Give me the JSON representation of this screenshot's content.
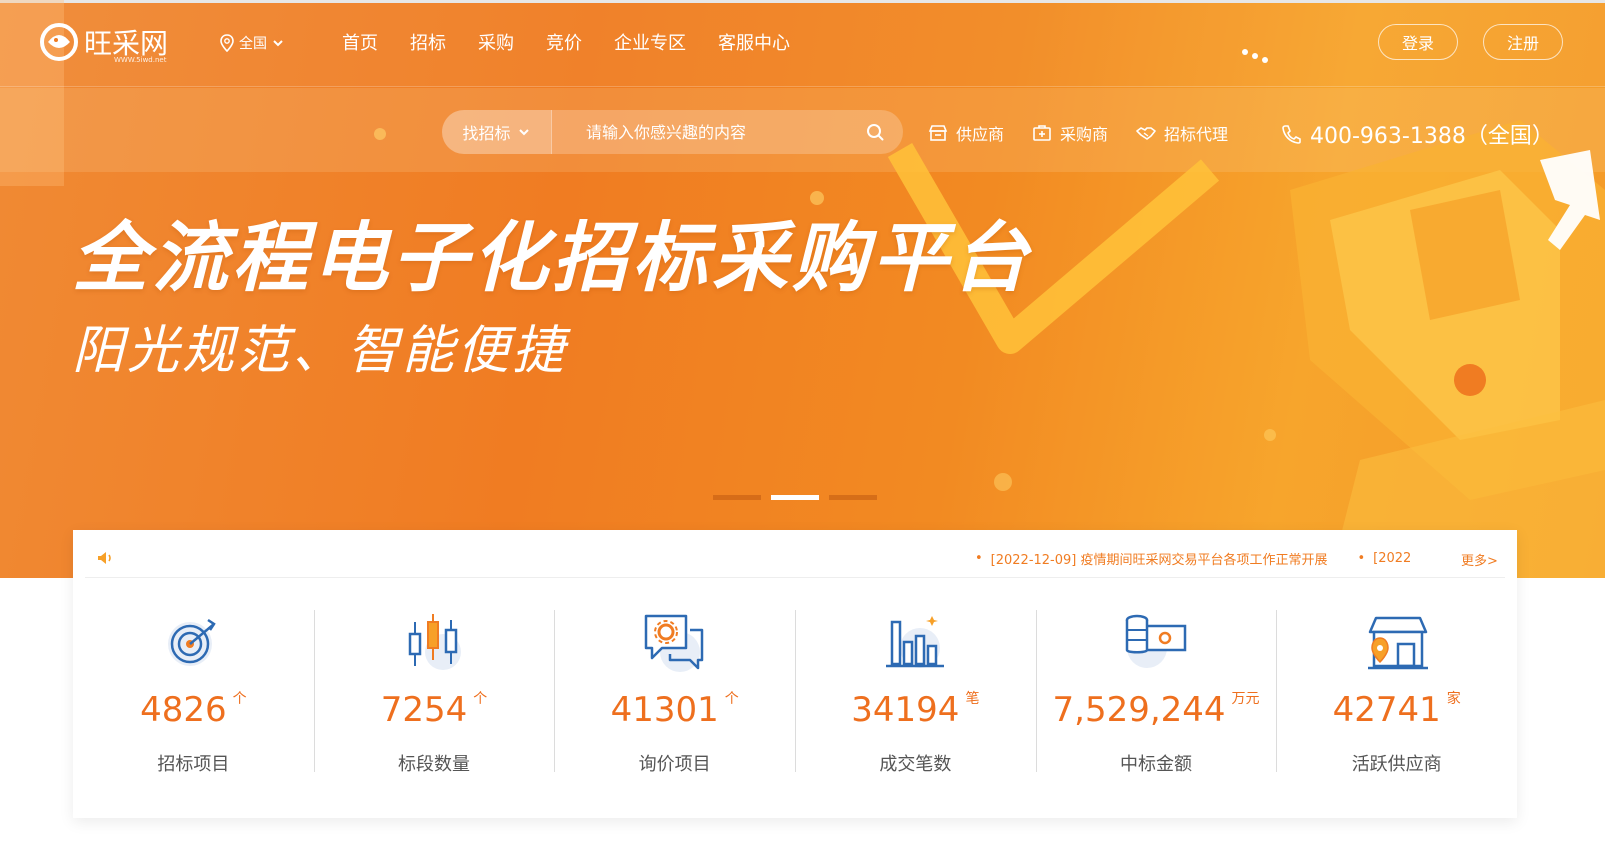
{
  "colors": {
    "brand": "#f07c22",
    "number": "#ee6f1e",
    "white": "#ffffff",
    "label": "#555555"
  },
  "header": {
    "logo_text": "旺采网",
    "logo_sub": "WWW.5iwd.net",
    "region": "全国",
    "nav": [
      "首页",
      "招标",
      "采购",
      "竞价",
      "企业专区",
      "客服中心"
    ],
    "login": "登录",
    "register": "注册"
  },
  "search": {
    "type": "找招标",
    "placeholder": "请输入你感兴趣的内容",
    "icon": "search-icon"
  },
  "quick_links": [
    {
      "label": "供应商",
      "icon": "shop-icon"
    },
    {
      "label": "采购商",
      "icon": "purchase-icon"
    },
    {
      "label": "招标代理",
      "icon": "handshake-icon"
    }
  ],
  "hotline": {
    "number": "400-963-1388（全国）",
    "icon": "phone-icon"
  },
  "hero": {
    "title": "全流程电子化招标采购平台",
    "subtitle": "阳光规范、智能便捷",
    "slides": 3,
    "active_slide": 2
  },
  "notice": {
    "items": [
      "[2022-12-09] 疫情期间旺采网交易平台各项工作正常开展",
      "[2022"
    ],
    "more": "更多>"
  },
  "stats": [
    {
      "value": "4826",
      "unit": "个",
      "label": "招标项目",
      "icon": "target-icon"
    },
    {
      "value": "7254",
      "unit": "个",
      "label": "标段数量",
      "icon": "candlestick-icon"
    },
    {
      "value": "41301",
      "unit": "个",
      "label": "询价项目",
      "icon": "chat-gear-icon"
    },
    {
      "value": "34194",
      "unit": "笔",
      "label": "成交笔数",
      "icon": "bar-chart-icon"
    },
    {
      "value": "7,529,244",
      "unit": "万元",
      "label": "中标金额",
      "icon": "money-icon"
    },
    {
      "value": "42741",
      "unit": "家",
      "label": "活跃供应商",
      "icon": "store-icon"
    }
  ]
}
